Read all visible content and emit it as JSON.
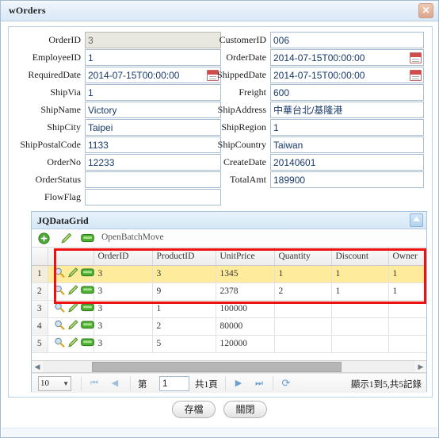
{
  "window": {
    "title": "wOrders",
    "close_label": "✕"
  },
  "form": {
    "left_fields": [
      {
        "label": "OrderID",
        "value": "3",
        "readonly": true,
        "date": false
      },
      {
        "label": "EmployeeID",
        "value": "1",
        "readonly": false,
        "date": false
      },
      {
        "label": "RequiredDate",
        "value": "2014-07-15T00:00:00",
        "readonly": false,
        "date": true
      },
      {
        "label": "ShipVia",
        "value": "1",
        "readonly": false,
        "date": false
      },
      {
        "label": "ShipName",
        "value": "Victory",
        "readonly": false,
        "date": false
      },
      {
        "label": "ShipCity",
        "value": "Taipei",
        "readonly": false,
        "date": false
      },
      {
        "label": "ShipPostalCode",
        "value": "1133",
        "readonly": false,
        "date": false
      },
      {
        "label": "OrderNo",
        "value": "12233",
        "readonly": false,
        "date": false
      },
      {
        "label": "OrderStatus",
        "value": "",
        "readonly": false,
        "date": false
      },
      {
        "label": "FlowFlag",
        "value": "",
        "readonly": false,
        "date": false
      }
    ],
    "right_fields": [
      {
        "label": "CustomerID",
        "value": "006",
        "readonly": false,
        "date": false
      },
      {
        "label": "OrderDate",
        "value": "2014-07-15T00:00:00",
        "readonly": false,
        "date": true
      },
      {
        "label": "ShippedDate",
        "value": "2014-07-15T00:00:00",
        "readonly": false,
        "date": true
      },
      {
        "label": "Freight",
        "value": "600",
        "readonly": false,
        "date": false
      },
      {
        "label": "ShipAddress",
        "value": "中華台北/基隆港",
        "readonly": false,
        "date": false
      },
      {
        "label": "ShipRegion",
        "value": "1",
        "readonly": false,
        "date": false
      },
      {
        "label": "ShipCountry",
        "value": "Taiwan",
        "readonly": false,
        "date": false
      },
      {
        "label": "CreateDate",
        "value": "20140601",
        "readonly": false,
        "date": false
      },
      {
        "label": "TotalAmt",
        "value": "189900",
        "readonly": false,
        "date": false
      }
    ]
  },
  "grid": {
    "panel_title": "JQDataGrid",
    "toolbar": {
      "add_icon": "plus-circle-icon",
      "edit_icon": "pencil-icon",
      "delete_icon": "minus-box-icon",
      "link_label": "OpenBatchMove"
    },
    "columns": [
      "",
      "",
      "OrderID",
      "ProductID",
      "UnitPrice",
      "Quantity",
      "Discount",
      "Owner"
    ],
    "rows": [
      {
        "n": "1",
        "OrderID": "3",
        "ProductID": "3",
        "UnitPrice": "1345",
        "Quantity": "1",
        "Discount": "1",
        "Owner": "1",
        "selected": true
      },
      {
        "n": "2",
        "OrderID": "3",
        "ProductID": "9",
        "UnitPrice": "2378",
        "Quantity": "2",
        "Discount": "1",
        "Owner": "1",
        "selected": false
      },
      {
        "n": "3",
        "OrderID": "3",
        "ProductID": "1",
        "UnitPrice": "100000",
        "Quantity": "",
        "Discount": "",
        "Owner": "",
        "selected": false
      },
      {
        "n": "4",
        "OrderID": "3",
        "ProductID": "2",
        "UnitPrice": "80000",
        "Quantity": "",
        "Discount": "",
        "Owner": "",
        "selected": false
      },
      {
        "n": "5",
        "OrderID": "3",
        "ProductID": "5",
        "UnitPrice": "120000",
        "Quantity": "",
        "Discount": "",
        "Owner": "",
        "selected": false
      }
    ],
    "highlight_color": "#ee1111",
    "selected_row_color": "#ffeb9c"
  },
  "pager": {
    "page_size": "10",
    "caret": "▼",
    "first_label": "⏮",
    "prev_label": "◀",
    "page_prefix": "第",
    "page_value": "1",
    "page_suffix": "共1頁",
    "next_label": "▶",
    "last_label": "⏭",
    "refresh_label": "⟳",
    "info": "顯示1到5,共5記錄"
  },
  "footer": {
    "save_label": "存檔",
    "close_label": "關閉"
  }
}
